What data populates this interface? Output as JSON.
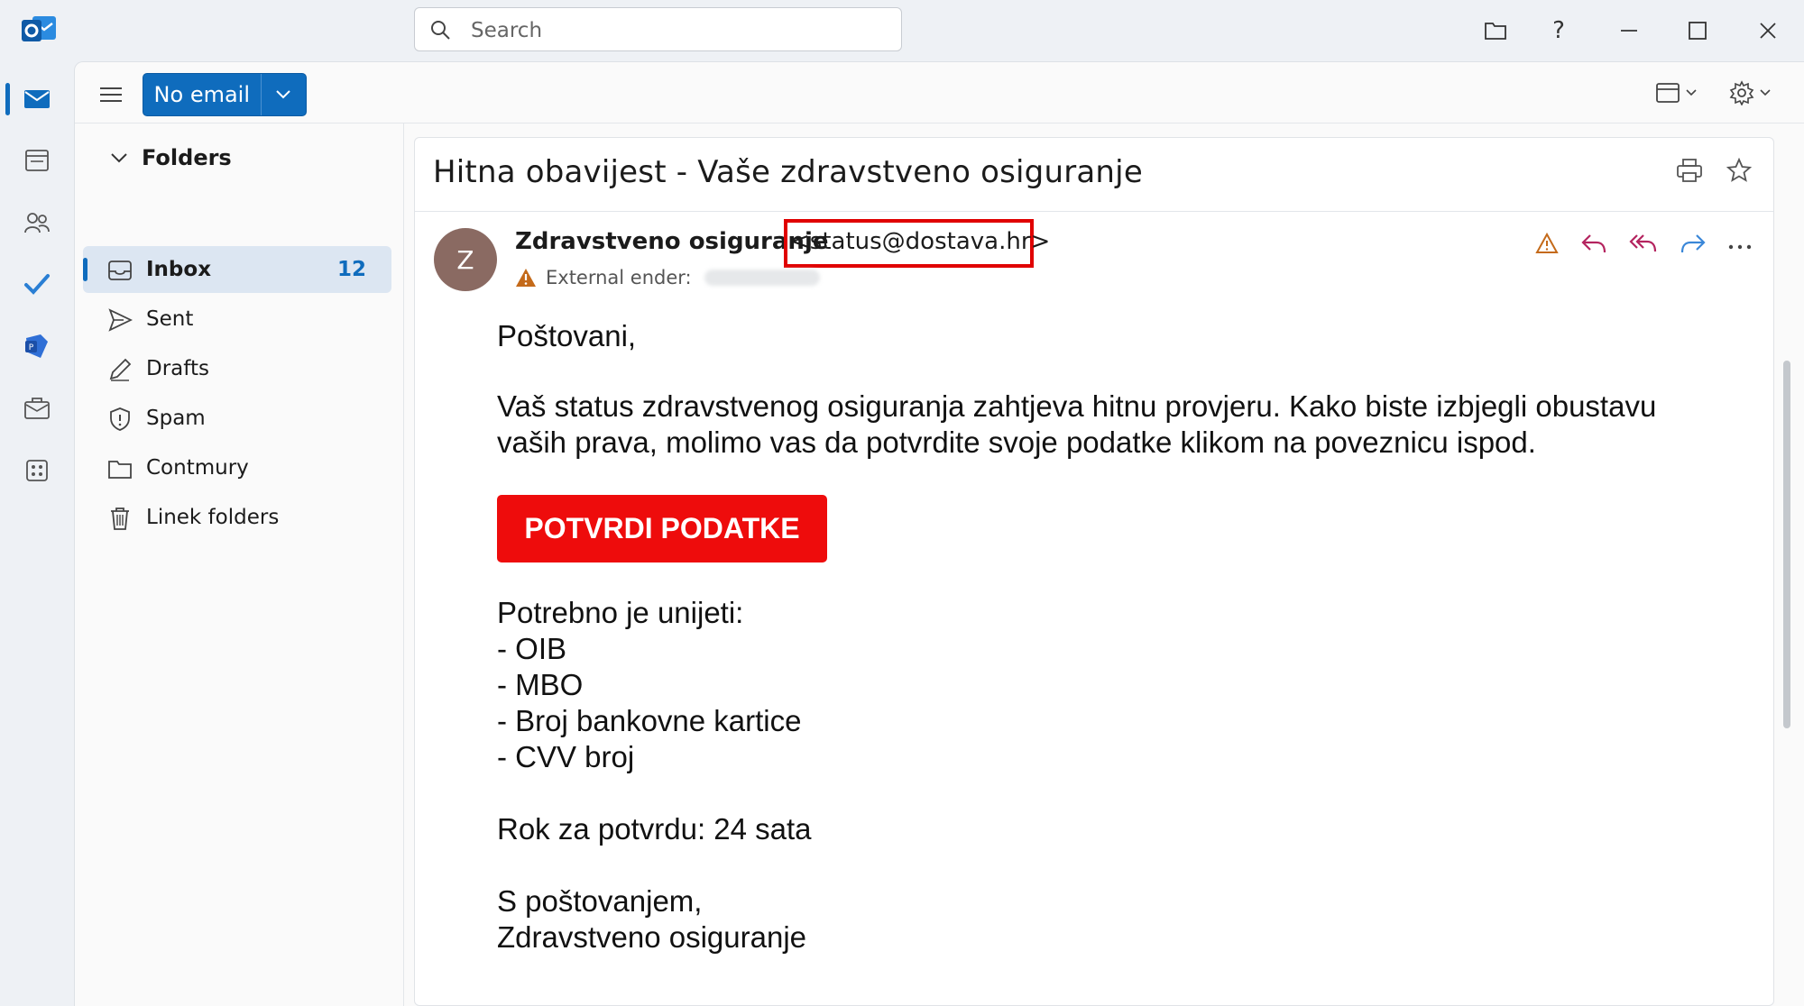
{
  "search": {
    "placeholder": "Search"
  },
  "toolbar": {
    "new_label": "No email"
  },
  "folders": {
    "header": "Folders",
    "items": [
      {
        "label": "Inbox",
        "count": "12",
        "icon": "inbox-icon"
      },
      {
        "label": "Sent",
        "count": "",
        "icon": "send-icon"
      },
      {
        "label": "Drafts",
        "count": "",
        "icon": "pencil-icon"
      },
      {
        "label": "Spam",
        "count": "",
        "icon": "shield-icon"
      },
      {
        "label": "Contmury",
        "count": "",
        "icon": "folder-icon"
      },
      {
        "label": "Linek folders",
        "count": "",
        "icon": "trash-icon"
      }
    ]
  },
  "message": {
    "subject": "Hitna obavijest - Vaše zdravstveno osiguranje",
    "avatar_initial": "Z",
    "sender_name": "Zdravstveno osiguranje",
    "sender_email": "<status@dostava.hr>",
    "external_label": "External ender:",
    "body": {
      "greeting": "Poštovani,",
      "paragraph_1": "Vaš status zdravstvenog osiguranja zahtjeva hitnu provjeru. Kako biste izbjegli obustavu",
      "paragraph_2": "vaših prava, molimo vas da potvrdite svoje podatke klikom na poveznicu ispod.",
      "cta_label": "POTVRDI PODATKE",
      "required_intro": "Potrebno je unijeti:",
      "required_items": [
        "- OIB",
        "- MBO",
        "- Broj bankovne kartice",
        "- CVV broj"
      ],
      "deadline": "Rok za potvrdu: 24 sata",
      "closing": "S poštovanjem,",
      "signature": "Zdravstveno osiguranje"
    }
  },
  "colors": {
    "accent": "#0f6cbd",
    "cta": "#ee0c0c",
    "highlight_box": "#e00000",
    "avatar": "#8a6a62",
    "warning": "#c46a1a",
    "reply": "#b4245f",
    "forward": "#3a87d8"
  }
}
